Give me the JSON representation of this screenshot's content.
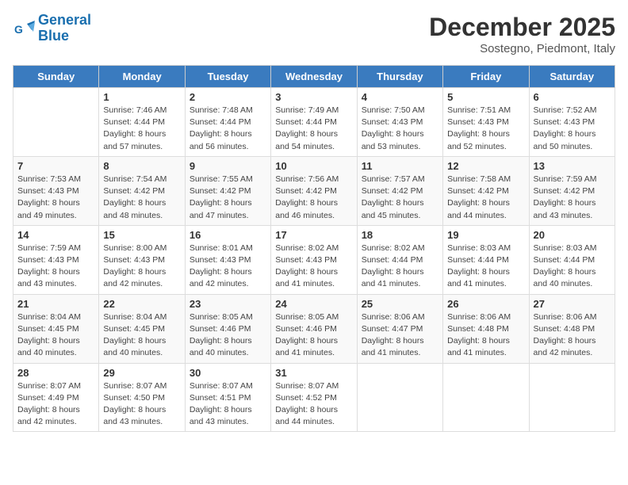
{
  "header": {
    "logo_line1": "General",
    "logo_line2": "Blue",
    "month": "December 2025",
    "location": "Sostegno, Piedmont, Italy"
  },
  "days_of_week": [
    "Sunday",
    "Monday",
    "Tuesday",
    "Wednesday",
    "Thursday",
    "Friday",
    "Saturday"
  ],
  "weeks": [
    [
      {
        "day": "",
        "info": ""
      },
      {
        "day": "1",
        "info": "Sunrise: 7:46 AM\nSunset: 4:44 PM\nDaylight: 8 hours\nand 57 minutes."
      },
      {
        "day": "2",
        "info": "Sunrise: 7:48 AM\nSunset: 4:44 PM\nDaylight: 8 hours\nand 56 minutes."
      },
      {
        "day": "3",
        "info": "Sunrise: 7:49 AM\nSunset: 4:44 PM\nDaylight: 8 hours\nand 54 minutes."
      },
      {
        "day": "4",
        "info": "Sunrise: 7:50 AM\nSunset: 4:43 PM\nDaylight: 8 hours\nand 53 minutes."
      },
      {
        "day": "5",
        "info": "Sunrise: 7:51 AM\nSunset: 4:43 PM\nDaylight: 8 hours\nand 52 minutes."
      },
      {
        "day": "6",
        "info": "Sunrise: 7:52 AM\nSunset: 4:43 PM\nDaylight: 8 hours\nand 50 minutes."
      }
    ],
    [
      {
        "day": "7",
        "info": "Sunrise: 7:53 AM\nSunset: 4:43 PM\nDaylight: 8 hours\nand 49 minutes."
      },
      {
        "day": "8",
        "info": "Sunrise: 7:54 AM\nSunset: 4:42 PM\nDaylight: 8 hours\nand 48 minutes."
      },
      {
        "day": "9",
        "info": "Sunrise: 7:55 AM\nSunset: 4:42 PM\nDaylight: 8 hours\nand 47 minutes."
      },
      {
        "day": "10",
        "info": "Sunrise: 7:56 AM\nSunset: 4:42 PM\nDaylight: 8 hours\nand 46 minutes."
      },
      {
        "day": "11",
        "info": "Sunrise: 7:57 AM\nSunset: 4:42 PM\nDaylight: 8 hours\nand 45 minutes."
      },
      {
        "day": "12",
        "info": "Sunrise: 7:58 AM\nSunset: 4:42 PM\nDaylight: 8 hours\nand 44 minutes."
      },
      {
        "day": "13",
        "info": "Sunrise: 7:59 AM\nSunset: 4:42 PM\nDaylight: 8 hours\nand 43 minutes."
      }
    ],
    [
      {
        "day": "14",
        "info": "Sunrise: 7:59 AM\nSunset: 4:43 PM\nDaylight: 8 hours\nand 43 minutes."
      },
      {
        "day": "15",
        "info": "Sunrise: 8:00 AM\nSunset: 4:43 PM\nDaylight: 8 hours\nand 42 minutes."
      },
      {
        "day": "16",
        "info": "Sunrise: 8:01 AM\nSunset: 4:43 PM\nDaylight: 8 hours\nand 42 minutes."
      },
      {
        "day": "17",
        "info": "Sunrise: 8:02 AM\nSunset: 4:43 PM\nDaylight: 8 hours\nand 41 minutes."
      },
      {
        "day": "18",
        "info": "Sunrise: 8:02 AM\nSunset: 4:44 PM\nDaylight: 8 hours\nand 41 minutes."
      },
      {
        "day": "19",
        "info": "Sunrise: 8:03 AM\nSunset: 4:44 PM\nDaylight: 8 hours\nand 41 minutes."
      },
      {
        "day": "20",
        "info": "Sunrise: 8:03 AM\nSunset: 4:44 PM\nDaylight: 8 hours\nand 40 minutes."
      }
    ],
    [
      {
        "day": "21",
        "info": "Sunrise: 8:04 AM\nSunset: 4:45 PM\nDaylight: 8 hours\nand 40 minutes."
      },
      {
        "day": "22",
        "info": "Sunrise: 8:04 AM\nSunset: 4:45 PM\nDaylight: 8 hours\nand 40 minutes."
      },
      {
        "day": "23",
        "info": "Sunrise: 8:05 AM\nSunset: 4:46 PM\nDaylight: 8 hours\nand 40 minutes."
      },
      {
        "day": "24",
        "info": "Sunrise: 8:05 AM\nSunset: 4:46 PM\nDaylight: 8 hours\nand 41 minutes."
      },
      {
        "day": "25",
        "info": "Sunrise: 8:06 AM\nSunset: 4:47 PM\nDaylight: 8 hours\nand 41 minutes."
      },
      {
        "day": "26",
        "info": "Sunrise: 8:06 AM\nSunset: 4:48 PM\nDaylight: 8 hours\nand 41 minutes."
      },
      {
        "day": "27",
        "info": "Sunrise: 8:06 AM\nSunset: 4:48 PM\nDaylight: 8 hours\nand 42 minutes."
      }
    ],
    [
      {
        "day": "28",
        "info": "Sunrise: 8:07 AM\nSunset: 4:49 PM\nDaylight: 8 hours\nand 42 minutes."
      },
      {
        "day": "29",
        "info": "Sunrise: 8:07 AM\nSunset: 4:50 PM\nDaylight: 8 hours\nand 43 minutes."
      },
      {
        "day": "30",
        "info": "Sunrise: 8:07 AM\nSunset: 4:51 PM\nDaylight: 8 hours\nand 43 minutes."
      },
      {
        "day": "31",
        "info": "Sunrise: 8:07 AM\nSunset: 4:52 PM\nDaylight: 8 hours\nand 44 minutes."
      },
      {
        "day": "",
        "info": ""
      },
      {
        "day": "",
        "info": ""
      },
      {
        "day": "",
        "info": ""
      }
    ]
  ]
}
